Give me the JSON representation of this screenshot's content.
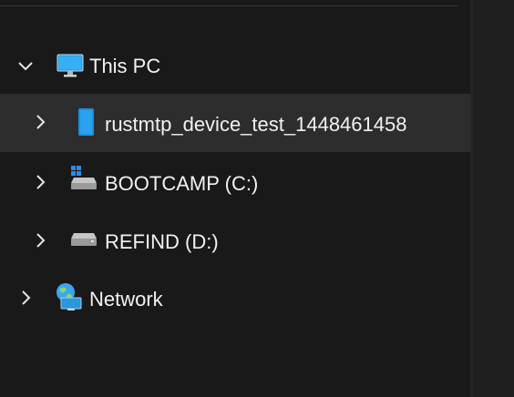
{
  "nav_tree": {
    "this_pc": {
      "label": "This PC",
      "expanded": true,
      "icon": "monitor-icon"
    },
    "items": [
      {
        "label": "rustmtp_device_test_1448461458",
        "icon": "portable-device-icon",
        "selected": true
      },
      {
        "label": "BOOTCAMP (C:)",
        "icon": "windows-drive-icon",
        "selected": false
      },
      {
        "label": "REFIND (D:)",
        "icon": "drive-icon",
        "selected": false
      }
    ],
    "network": {
      "label": "Network",
      "expanded": false,
      "icon": "network-icon"
    }
  },
  "colors": {
    "background": "#191919",
    "selected_row": "#2d2d2d",
    "text": "#f2f2f2",
    "device_blue": "#1e8fe0"
  }
}
